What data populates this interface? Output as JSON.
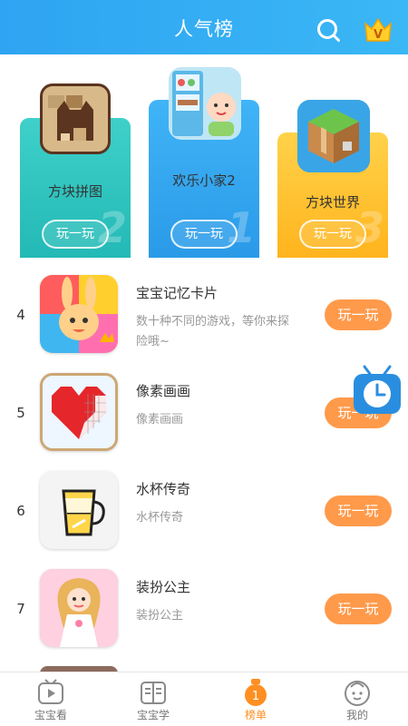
{
  "header": {
    "title": "人气榜"
  },
  "podium": [
    {
      "rank": "2",
      "name": "方块拼图",
      "play": "玩一玩"
    },
    {
      "rank": "1",
      "name": "欢乐小家2",
      "play": "玩一玩"
    },
    {
      "rank": "3",
      "name": "方块世界",
      "play": "玩一玩"
    }
  ],
  "list": [
    {
      "num": "4",
      "name": "宝宝记忆卡片",
      "desc": "数十种不同的游戏，等你来探险哦~",
      "play": "玩一玩"
    },
    {
      "num": "5",
      "name": "像素画画",
      "desc": "像素画画",
      "play": "玩一玩"
    },
    {
      "num": "6",
      "name": "水杯传奇",
      "desc": "水杯传奇",
      "play": "玩一玩"
    },
    {
      "num": "7",
      "name": "装扮公主",
      "desc": "装扮公主",
      "play": "玩一玩"
    }
  ],
  "tabs": [
    {
      "label": "宝宝看",
      "icon": "tv-icon"
    },
    {
      "label": "宝宝学",
      "icon": "book-icon"
    },
    {
      "label": "榜单",
      "icon": "medal-icon"
    },
    {
      "label": "我的",
      "icon": "face-icon"
    }
  ],
  "colors": {
    "header": "#2fa4f2",
    "play_button": "#ff9a4b",
    "tab_active": "#ff8f21"
  }
}
